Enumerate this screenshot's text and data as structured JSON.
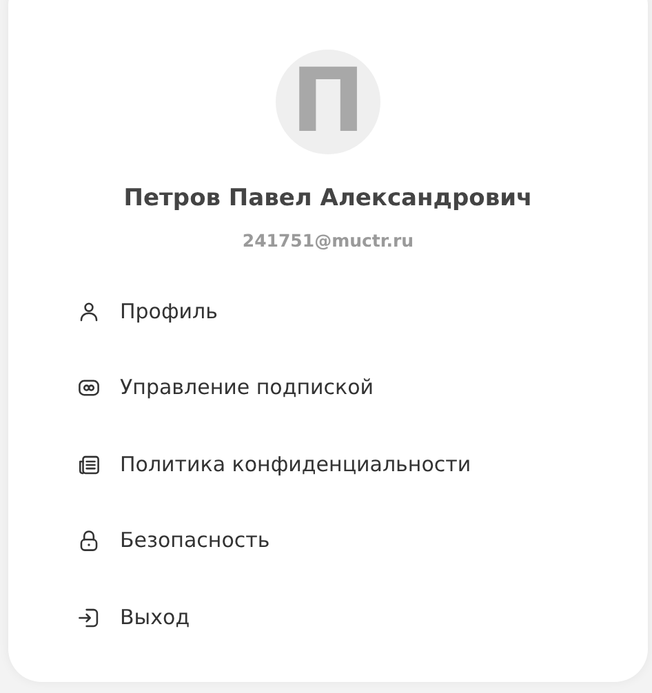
{
  "profile": {
    "avatar_letter": "П",
    "name": "Петров Павел Александрович",
    "email": "241751@muctr.ru"
  },
  "menu": [
    {
      "kind": "profile",
      "label": "Профиль"
    },
    {
      "kind": "subscription",
      "label": "Управление подпиской"
    },
    {
      "kind": "policy",
      "label": "Политика конфиденциальности"
    },
    {
      "kind": "security",
      "label": "Безопасность"
    },
    {
      "kind": "logout",
      "label": "Выход"
    }
  ]
}
